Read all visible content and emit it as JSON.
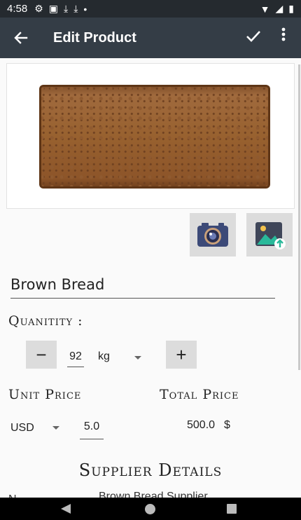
{
  "status_bar": {
    "time": "4:58",
    "icons": [
      "settings-icon",
      "photo-icon",
      "download-done-icon",
      "download-done-icon",
      "dot-icon"
    ],
    "right_icons": [
      "wifi-icon",
      "signal-icon",
      "battery-icon"
    ]
  },
  "app_bar": {
    "title": "Edit Product",
    "back_icon": "arrow-left-icon",
    "save_icon": "check-icon",
    "menu_icon": "more-vert-icon",
    "background": "#343d46"
  },
  "product": {
    "image_desc_icon": "bread-photo",
    "camera_icon": "camera-icon",
    "gallery_icon": "gallery-upload-icon",
    "name": "Brown Bread"
  },
  "quantity": {
    "label": "Quanitity :",
    "minus": "−",
    "value": "92",
    "unit": "kg",
    "plus": "+"
  },
  "pricing": {
    "unit_price_label": "Unit Price",
    "total_price_label": "Total Price",
    "currency": "USD",
    "unit_price_value": "5.0",
    "total_value": "500.0",
    "total_currency_symbol": "$"
  },
  "supplier": {
    "title": "Supplier Details",
    "name": "Brown Bread Supplier",
    "first_label": "N"
  },
  "nav_bar": {
    "icons": [
      "back-triangle-icon",
      "home-circle-icon",
      "recents-square-icon"
    ]
  }
}
